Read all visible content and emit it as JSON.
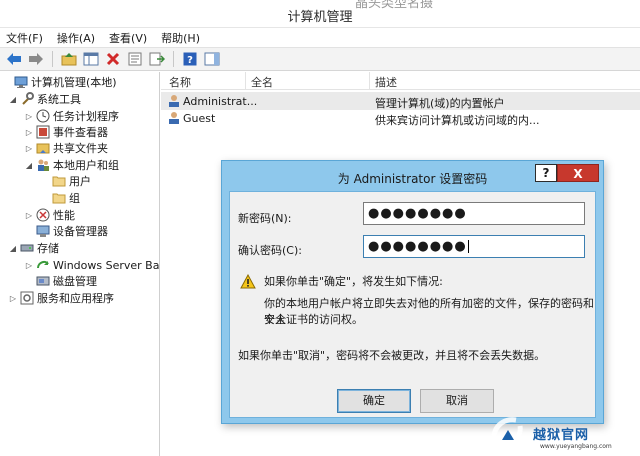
{
  "window": {
    "ghost_title": "晶头类型名摄",
    "title": "计算机管理"
  },
  "menu": [
    "文件(F)",
    "操作(A)",
    "查看(V)",
    "帮助(H)"
  ],
  "toolbar": {
    "icons": [
      "back-arrow-icon",
      "forward-arrow-icon",
      "up-folder-icon",
      "show-tree-icon",
      "delete-icon",
      "properties-icon",
      "export-icon",
      "help-icon",
      "action-pane-icon"
    ]
  },
  "tree": {
    "root": "计算机管理(本地)",
    "system_tools": "系统工具",
    "task_scheduler": "任务计划程序",
    "event_viewer": "事件查看器",
    "shared_folders": "共享文件夹",
    "local_users_groups": "本地用户和组",
    "users": "用户",
    "groups": "组",
    "performance": "性能",
    "device_manager": "设备管理器",
    "storage": "存储",
    "windows_server_backup": "Windows Server Back",
    "disk_management": "磁盘管理",
    "services_apps": "服务和应用程序"
  },
  "list": {
    "columns": [
      "名称",
      "全名",
      "描述"
    ],
    "rows": [
      {
        "name": "Administrat...",
        "fullname": "",
        "description": "管理计算机(域)的内置帐户"
      },
      {
        "name": "Guest",
        "fullname": "",
        "description": "供来宾访问计算机或访问域的内..."
      }
    ]
  },
  "dialog": {
    "title": "为 Administrator 设置密码",
    "help_label": "?",
    "close_label": "X",
    "new_password_label": "新密码(N):",
    "new_password_value": "●●●●●●●●",
    "confirm_password_label": "确认密码(C):",
    "confirm_password_value": "●●●●●●●●",
    "warning_line1": "如果你单击\"确定\"，将发生如下情况:",
    "warning_line2": "你的本地用户帐户将立即失去对他的所有加密的文件，保存的密码和个人",
    "warning_line3": "安全证书的访问权。",
    "cancel_note": "如果你单击\"取消\"，密码将不会被更改，并且将不会丢失数据。",
    "ok_label": "确定",
    "cancel_label": "取消"
  },
  "watermark": {
    "text": "越狱官网",
    "url": "www.yueyangbang.com"
  }
}
